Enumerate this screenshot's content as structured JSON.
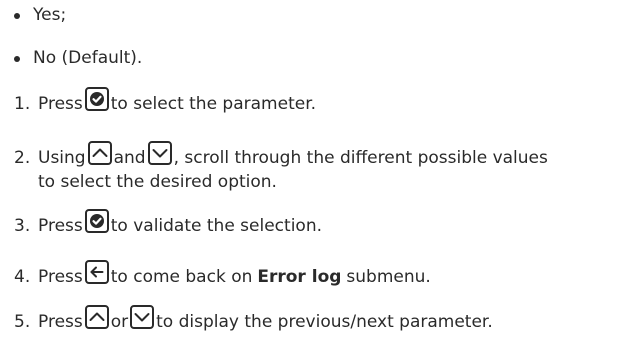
{
  "bullets": [
    "Yes;",
    "No (Default)."
  ],
  "steps": [
    {
      "number": "1.",
      "before": "Press",
      "after": "to select the parameter."
    },
    {
      "number": "2.",
      "before": "Using",
      "middle": "and",
      "after": ", scroll through the different possible values",
      "continuation": "to select the desired option."
    },
    {
      "number": "3.",
      "before": "Press",
      "after": "to validate the selection."
    },
    {
      "number": "4.",
      "before": "Press",
      "after_pre": "to come back on",
      "bold": "Error log",
      "after_post": "submenu."
    },
    {
      "number": "5.",
      "before": "Press",
      "middle": "or",
      "after": "to display the previous/next parameter."
    }
  ],
  "icons": {
    "validate": "check-circle-icon",
    "up": "up-arrow-icon",
    "down": "down-arrow-icon",
    "back": "back-arrow-icon"
  }
}
